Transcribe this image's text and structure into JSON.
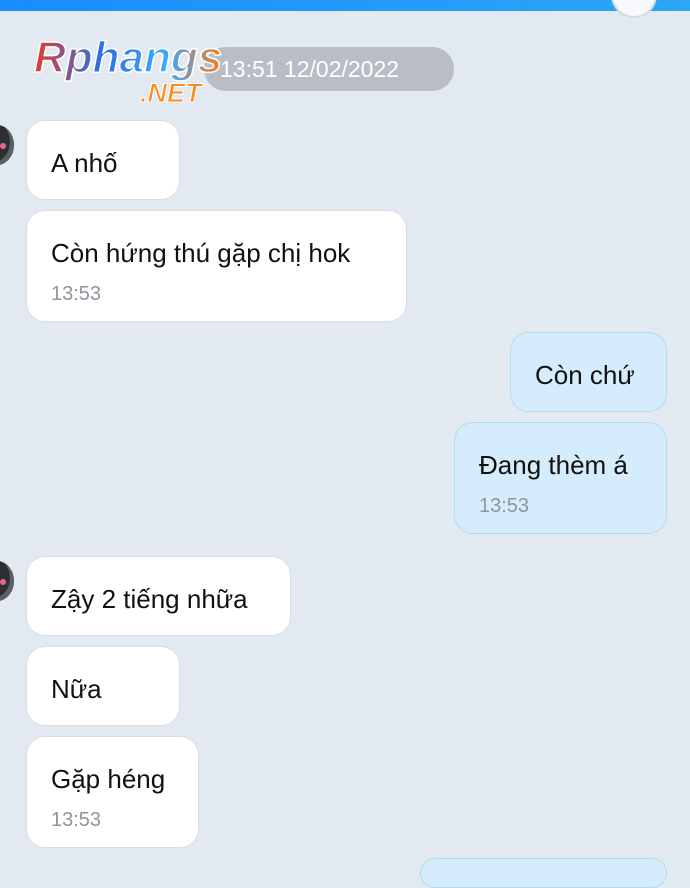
{
  "header": {
    "date_pill": "13:51 12/02/2022"
  },
  "watermark": {
    "line1": "Rphangs",
    "line2": ".NET"
  },
  "messages": [
    {
      "text": "A nhố"
    },
    {
      "text": "Còn hứng thú gặp chị hok",
      "time": "13:53"
    },
    {
      "text": "Còn chứ"
    },
    {
      "text": "Đang thèm á",
      "time": "13:53"
    },
    {
      "text": "Zậy 2 tiếng nhữa"
    },
    {
      "text": "Nữa"
    },
    {
      "text": "Gặp héng",
      "time": "13:53"
    }
  ],
  "colors": {
    "incoming_bubble": "#ffffff",
    "outgoing_bubble": "#d4ecfb",
    "background": "#e3e9f1",
    "accent": "#1a8cff"
  }
}
